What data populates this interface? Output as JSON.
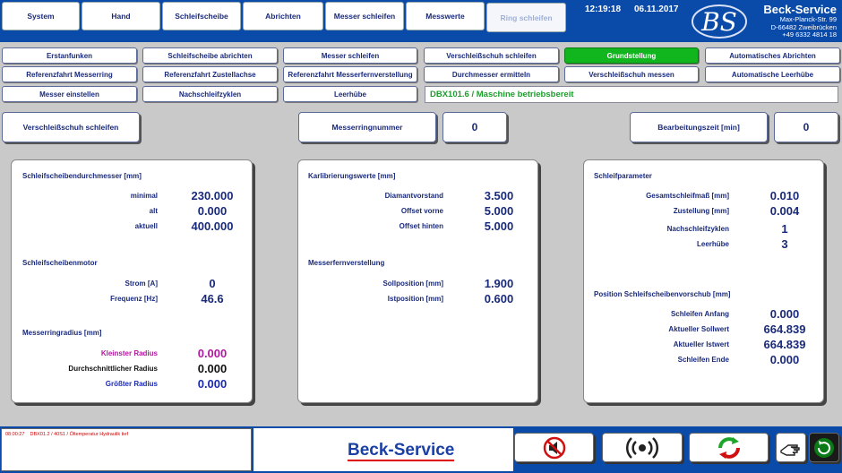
{
  "header": {
    "tabs": [
      {
        "label": "System",
        "active": false
      },
      {
        "label": "Hand",
        "active": false
      },
      {
        "label": "Schleifscheibe",
        "active": false
      },
      {
        "label": "Abrichten",
        "active": false
      },
      {
        "label": "Messer schleifen",
        "active": false
      },
      {
        "label": "Messwerte",
        "active": false
      },
      {
        "label": "Ring schleifen",
        "active": true
      }
    ],
    "time": "12:19:18",
    "date": "06.11.2017",
    "logo_letters": "BS",
    "brand": {
      "name": "Beck-Service",
      "street": "Max-Planck-Str. 99",
      "city": "D-66482 Zweibrücken",
      "phone": "+49 6332 4814 18"
    }
  },
  "buttons": {
    "row1": [
      "Erstanfunken",
      "Schleifscheibe abrichten",
      "Messer schleifen",
      "Verschleißschuh schleifen",
      "Grundstellung",
      "Automatisches Abrichten"
    ],
    "row2": [
      "Referenzfahrt Messerring",
      "Referenzfahrt Zustellachse",
      "Referenzfahrt Messerfernverstellung",
      "Durchmesser ermitteln",
      "Verschleißschuh messen",
      "Automatische Leerhübe"
    ],
    "row3": [
      "Messer einstellen",
      "Nachschleifzyklen",
      "Leerhübe"
    ],
    "active_color": "#11b51e"
  },
  "status": "DBX101.6 / Maschine betriebsbereit",
  "row2": {
    "mode_button": "Verschleißschuh schleifen",
    "ring_label": "Messerringnummer",
    "ring_value": "0",
    "time_label": "Bearbeitungszeit [min]",
    "time_value": "0"
  },
  "panel1": {
    "title1": "Schleifscheibendurchmesser [mm]",
    "rows1": [
      {
        "label": "minimal",
        "value": "230.000"
      },
      {
        "label": "alt",
        "value": "0.000"
      },
      {
        "label": "aktuell",
        "value": "400.000"
      }
    ],
    "title2": "Schleifscheibenmotor",
    "rows2": [
      {
        "label": "Strom [A]",
        "value": "0"
      },
      {
        "label": "Frequenz [Hz]",
        "value": "46.6"
      }
    ],
    "title3": "Messerringradius [mm]",
    "rows3": [
      {
        "label": "Kleinster Radius",
        "value": "0.000",
        "color": "#b0199e"
      },
      {
        "label": "Durchschnittlicher Radius",
        "value": "0.000",
        "color": "#111111"
      },
      {
        "label": "Größter Radius",
        "value": "0.000",
        "color": "#1a2ab0"
      }
    ]
  },
  "panel2": {
    "title1": "Karlibrierungswerte [mm]",
    "rows1": [
      {
        "label": "Diamantvorstand",
        "value": "3.500"
      },
      {
        "label": "Offset vorne",
        "value": "5.000"
      },
      {
        "label": "Offset hinten",
        "value": "5.000"
      }
    ],
    "title2": "Messerfernverstellung",
    "rows2": [
      {
        "label": "Sollposition [mm]",
        "value": "1.900"
      },
      {
        "label": "Istposition [mm]",
        "value": "0.600"
      }
    ]
  },
  "panel3": {
    "title1": "Schleifparameter",
    "rows1": [
      {
        "label": "Gesamtschleifmaß [mm]",
        "value": "0.010"
      },
      {
        "label": "Zustellung [mm]",
        "value": "0.004"
      },
      {
        "label": "Nachschleifzyklen",
        "value": "1"
      },
      {
        "label": "Leerhübe",
        "value": "3"
      }
    ],
    "title2": "Position Schleifscheibenvorschub [mm]",
    "rows2": [
      {
        "label": "Schleifen Anfang",
        "value": "0.000"
      },
      {
        "label": "Aktueller Sollwert",
        "value": "664.839"
      },
      {
        "label": "Aktueller Istwert",
        "value": "664.839"
      },
      {
        "label": "Schleifen Ende",
        "value": "0.000"
      }
    ]
  },
  "footer": {
    "alarm_time": "08:00:27",
    "alarm_text": "DBX01.2 / 40S1 / Öltemperatur Hydraulik tief",
    "logo": "Beck-Service",
    "icons": [
      "sound-off-icon",
      "horn-icon",
      "reset-icon",
      "hand-icon",
      "auto-cycle-icon"
    ]
  }
}
